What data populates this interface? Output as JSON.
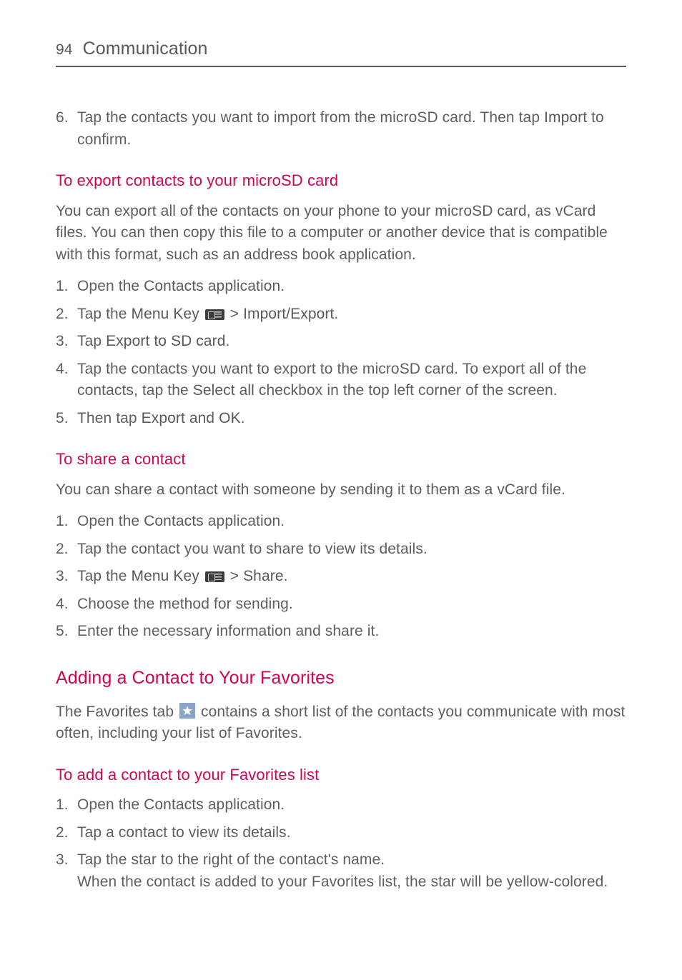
{
  "header": {
    "page_number": "94",
    "section": "Communication"
  },
  "continuation_step": {
    "num": "6.",
    "text_a": "Tap the contacts you want to import from the microSD card. Then tap ",
    "bold": "Import",
    "text_b": " to confirm."
  },
  "export": {
    "heading": "To export contacts to your microSD card",
    "intro": "You can export all of the contacts on your phone to your microSD card, as vCard files. You can then copy this file to a computer or another device that is compatible with this format, such as an address book application.",
    "steps": {
      "s1": {
        "num": "1.",
        "a": "Open the ",
        "b1": "Contacts",
        "c": " application."
      },
      "s2": {
        "num": "2.",
        "a": "Tap the ",
        "b1": "Menu Key",
        "mid": " > ",
        "b2": "Import/Export",
        "c": "."
      },
      "s3": {
        "num": "3.",
        "a": "Tap ",
        "b1": "Export to SD card",
        "c": "."
      },
      "s4": {
        "num": "4.",
        "a": "Tap the contacts you want to export to the microSD card. To export all of the contacts, tap the ",
        "b1": "Select all",
        "c": " checkbox in the top left corner of the screen."
      },
      "s5": {
        "num": "5.",
        "a": "Then tap ",
        "b1": "Export",
        "mid": " and ",
        "b2": "OK",
        "c": "."
      }
    }
  },
  "share": {
    "heading": "To share a contact",
    "intro": "You can share a contact with someone by sending it to them as a vCard file.",
    "steps": {
      "s1": {
        "num": "1.",
        "a": "Open the ",
        "b1": "Contacts",
        "c": " application."
      },
      "s2": {
        "num": "2.",
        "text": "Tap the contact you want to share to view its details."
      },
      "s3": {
        "num": "3.",
        "a": "Tap the ",
        "b1": "Menu Key",
        "mid": " > ",
        "b2": "Share",
        "c": "."
      },
      "s4": {
        "num": "4.",
        "text": "Choose the method for sending."
      },
      "s5": {
        "num": "5.",
        "text": "Enter the necessary information and share it."
      }
    }
  },
  "favorites": {
    "heading": "Adding a Contact to Your Favorites",
    "intro_a": "The ",
    "intro_bold": "Favorites",
    "intro_b": " tab ",
    "intro_c": " contains a short list of the contacts you communicate with most often, including your list of Favorites.",
    "sub_heading": "To add a contact to your Favorites list",
    "steps": {
      "s1": {
        "num": "1.",
        "a": "Open the ",
        "b1": "Contacts",
        "c": " application."
      },
      "s2": {
        "num": "2.",
        "text": "Tap a contact to view its details."
      },
      "s3": {
        "num": "3.",
        "line1": "Tap the star to the right of the contact's name.",
        "line2": "When the contact is added to your Favorites list, the star will be yellow-colored."
      }
    }
  }
}
